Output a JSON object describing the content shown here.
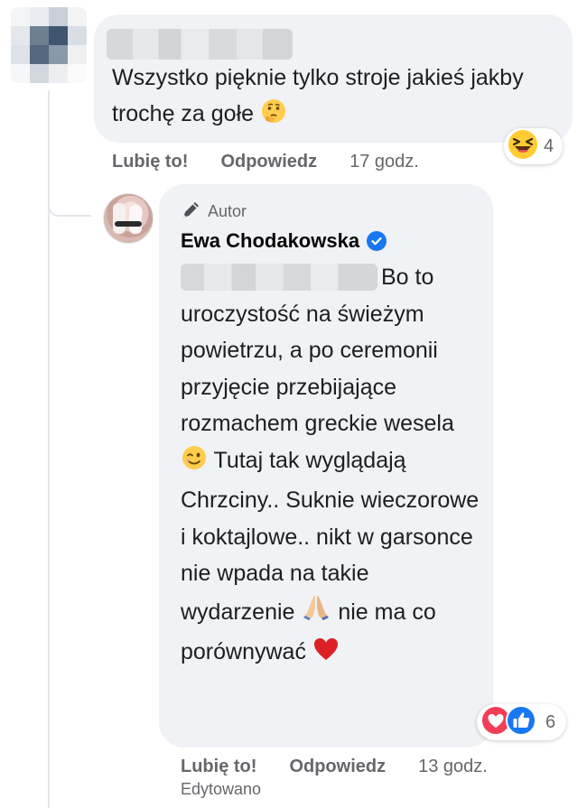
{
  "comment_1": {
    "text": "Wszystko pięknie tylko stroje jakieś jakby trochę za gołe",
    "reactions": {
      "icon": "laughing-face-icon",
      "count": "4"
    },
    "actions": {
      "like": "Lubię to!",
      "reply": "Odpowiedz",
      "time": "17 godz."
    }
  },
  "reply": {
    "badge": "Autor",
    "author": "Ewa Chodakowska",
    "text_1": "Bo to uroczystość na świeżym powietrzu, a po ceremonii przyjęcie przebijające rozmachem greckie wesela",
    "text_2": " Tutaj tak wyglądają Chrzciny.. Suknie wieczorowe i koktajlowe.. nikt w garsonce nie wpada na takie wydarzenie",
    "text_3": " nie ma co porównywać",
    "reactions": {
      "icons": [
        "heart-reaction-icon",
        "like-reaction-icon"
      ],
      "count": "6"
    },
    "actions": {
      "like": "Lubię to!",
      "reply": "Odpowiedz",
      "time": "13 godz."
    },
    "edited": "Edytowano"
  },
  "colors": {
    "bubble": "#f0f2f5",
    "secondary_text": "#65676b",
    "verified_blue": "#1877f2",
    "heart_red": "#f33e58"
  }
}
